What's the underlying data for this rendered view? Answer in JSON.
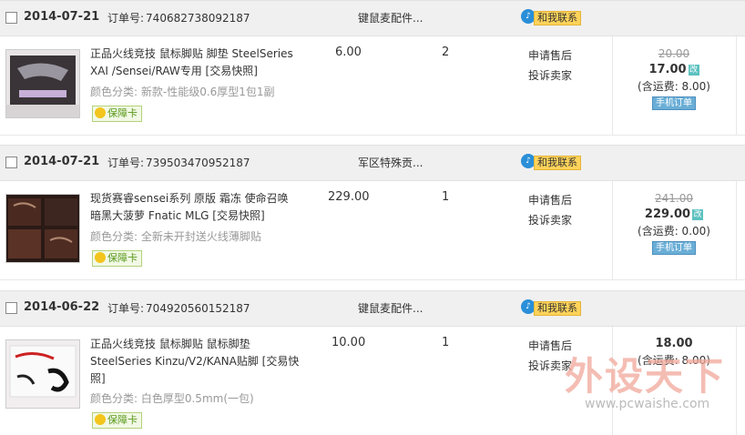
{
  "orders": [
    {
      "date": "2014-07-21",
      "order_no_label": "订单号:",
      "order_no": "740682738092187",
      "shop": "键鼠麦配件...",
      "contact_label": "和我联系",
      "title": "正品火线竞技 鼠标脚贴 脚垫 SteelSeries XAI /Sensei/RAW专用 [交易快照]",
      "sku": "颜色分类: 新款-性能级0.6厚型1包1副",
      "guarantee_label": "保障卡",
      "price": "6.00",
      "qty": "2",
      "after_sale": "申请售后",
      "complain": "投诉卖家",
      "original_total": "20.00",
      "final_total": "17.00",
      "edit_mark": "改",
      "shipping": "(含运费: 8.00)",
      "mobile_order": "手机订单"
    },
    {
      "date": "2014-07-21",
      "order_no_label": "订单号:",
      "order_no": "739503470952187",
      "shop": "军区特殊贡...",
      "contact_label": "和我联系",
      "title": "现货赛睿sensei系列 原版 霜冻 使命召唤 暗黑大菠萝 Fnatic MLG [交易快照]",
      "sku": "颜色分类: 全新未开封送火线薄脚贴",
      "guarantee_label": "保障卡",
      "price": "229.00",
      "qty": "1",
      "after_sale": "申请售后",
      "complain": "投诉卖家",
      "original_total": "241.00",
      "final_total": "229.00",
      "edit_mark": "改",
      "shipping": "(含运费: 0.00)",
      "mobile_order": "手机订单"
    },
    {
      "date": "2014-06-22",
      "order_no_label": "订单号:",
      "order_no": "704920560152187",
      "shop": "键鼠麦配件...",
      "contact_label": "和我联系",
      "title": "正品火线竞技 鼠标脚贴 鼠标脚垫 SteelSeries Kinzu/V2/KANA贴脚 [交易快照]",
      "sku": "颜色分类: 白色厚型0.5mm(一包)",
      "guarantee_label": "保障卡",
      "price": "10.00",
      "qty": "1",
      "after_sale": "申请售后",
      "complain": "投诉卖家",
      "final_total": "18.00",
      "shipping": "(含运费: 8.00)"
    }
  ],
  "watermark": {
    "brand": "外设天下",
    "url": "www.pcwaishe.com"
  },
  "colors": {
    "header_bg": "#f0f0f0",
    "contact_tag": "#ffd35a",
    "guarantee_text": "#5b9a1c",
    "edit_mark": "#5cc1c0",
    "mobile_badge": "#6aaed6"
  }
}
